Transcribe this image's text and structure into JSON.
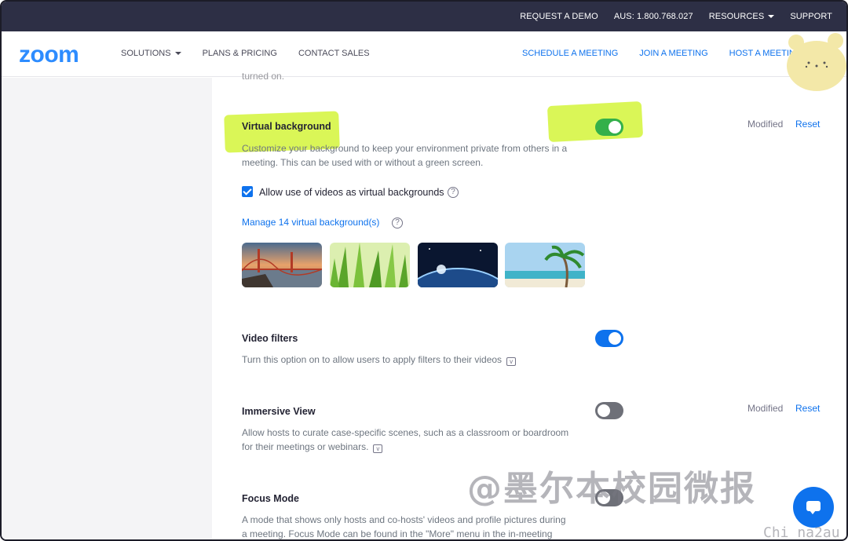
{
  "topbar": {
    "request_demo": "REQUEST A DEMO",
    "phone": "AUS: 1.800.768.027",
    "resources": "RESOURCES",
    "support": "SUPPORT"
  },
  "nav": {
    "logo": "zoom",
    "solutions": "SOLUTIONS",
    "plans": "PLANS & PRICING",
    "contact": "CONTACT SALES",
    "schedule": "SCHEDULE A MEETING",
    "join": "JOIN A MEETING",
    "host": "HOST A MEETING"
  },
  "faded_text": "turned on.",
  "settings": {
    "virtual_background": {
      "title": "Virtual background",
      "desc_line1": "Customize your background to keep your environment private from others in a",
      "desc_line2": "meeting. This can be used with or without a green screen.",
      "modified": "Modified",
      "reset": "Reset",
      "checkbox_label": "Allow use of videos as virtual backgrounds",
      "manage_link": "Manage 14 virtual background(s)",
      "enabled": true
    },
    "video_filters": {
      "title": "Video filters",
      "desc": "Turn this option on to allow users to apply filters to their videos",
      "enabled": true
    },
    "immersive_view": {
      "title": "Immersive View",
      "desc_line1": "Allow hosts to curate case-specific scenes, such as a classroom or boardroom",
      "desc_line2": "for their meetings or webinars.",
      "modified": "Modified",
      "reset": "Reset",
      "enabled": false
    },
    "focus_mode": {
      "title": "Focus Mode",
      "desc_line1": "A mode that shows only hosts and co-hosts' videos and profile pictures during",
      "desc_line2": "a meeting. Focus Mode can be found in the \"More\" menu in the in-meeting",
      "enabled": false
    }
  },
  "icons": {
    "help": "?",
    "vtag": "v"
  },
  "watermark": "@墨尔本校园微报",
  "watermark2": "Chi na2au",
  "colors": {
    "accent": "#0e72ed",
    "topbar": "#2d2f45",
    "highlight": "#d4f53a"
  }
}
